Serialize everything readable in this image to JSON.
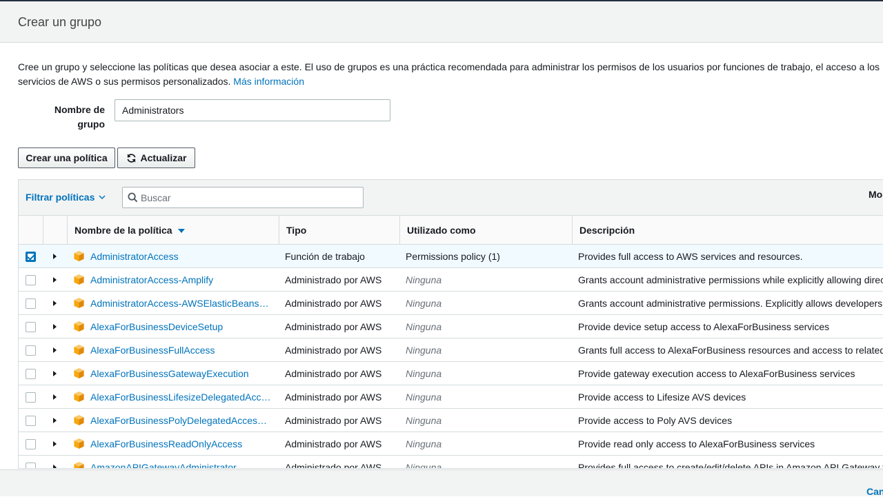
{
  "modal": {
    "title": "Crear un grupo",
    "intro_text": "Cree un grupo y seleccione las políticas que desea asociar a este. El uso de grupos es una práctica recomendada para administrar los permisos de los usuarios por funciones de trabajo, el acceso a los servicios de AWS o sus permisos personalizados.",
    "more_info_link": "Más información",
    "cancel_label": "Cancelar"
  },
  "form": {
    "group_name_label": "Nombre de grupo",
    "group_name_value": "Administrators"
  },
  "toolbar": {
    "create_policy_label": "Crear una política",
    "refresh_label": "Actualizar"
  },
  "filter": {
    "filter_label": "Filtrar políticas",
    "search_placeholder": "Buscar",
    "right_label": "Mo"
  },
  "table": {
    "headers": {
      "name": "Nombre de la política",
      "type": "Tipo",
      "used_as": "Utilizado como",
      "description": "Descripción"
    },
    "rows": [
      {
        "name": "AdministratorAccess",
        "type": "Función de trabajo",
        "used_as": "Permissions policy (1)",
        "description": "Provides full access to AWS services and resources.",
        "checked": true
      },
      {
        "name": "AdministratorAccess-Amplify",
        "type": "Administrado por AWS",
        "used_as": "Ninguna",
        "description": "Grants account administrative permissions while explicitly allowing direct",
        "checked": false
      },
      {
        "name": "AdministratorAccess-AWSElasticBeansta...",
        "type": "Administrado por AWS",
        "used_as": "Ninguna",
        "description": "Grants account administrative permissions. Explicitly allows developers a",
        "checked": false
      },
      {
        "name": "AlexaForBusinessDeviceSetup",
        "type": "Administrado por AWS",
        "used_as": "Ninguna",
        "description": "Provide device setup access to AlexaForBusiness services",
        "checked": false
      },
      {
        "name": "AlexaForBusinessFullAccess",
        "type": "Administrado por AWS",
        "used_as": "Ninguna",
        "description": "Grants full access to AlexaForBusiness resources and access to related A",
        "checked": false
      },
      {
        "name": "AlexaForBusinessGatewayExecution",
        "type": "Administrado por AWS",
        "used_as": "Ninguna",
        "description": "Provide gateway execution access to AlexaForBusiness services",
        "checked": false
      },
      {
        "name": "AlexaForBusinessLifesizeDelegatedAcce...",
        "type": "Administrado por AWS",
        "used_as": "Ninguna",
        "description": "Provide access to Lifesize AVS devices",
        "checked": false
      },
      {
        "name": "AlexaForBusinessPolyDelegatedAccessP...",
        "type": "Administrado por AWS",
        "used_as": "Ninguna",
        "description": "Provide access to Poly AVS devices",
        "checked": false
      },
      {
        "name": "AlexaForBusinessReadOnlyAccess",
        "type": "Administrado por AWS",
        "used_as": "Ninguna",
        "description": "Provide read only access to AlexaForBusiness services",
        "checked": false
      },
      {
        "name": "AmazonAPIGatewayAdministrator",
        "type": "Administrado por AWS",
        "used_as": "Ninguna",
        "description": "Provides full access to create/edit/delete APIs in Amazon API Gateway vi",
        "checked": false
      }
    ]
  },
  "icons": {
    "refresh": "refresh-icon",
    "chevron": "chevron-down-icon",
    "search": "search-icon",
    "sort": "sort-desc-icon",
    "policy": "policy-box-icon",
    "expand": "expand-caret-icon"
  },
  "colors": {
    "link": "#0073bb",
    "policy_icon": "#f7a80d",
    "header_bg": "#f2f3f3",
    "selected_row": "#f1faff"
  }
}
